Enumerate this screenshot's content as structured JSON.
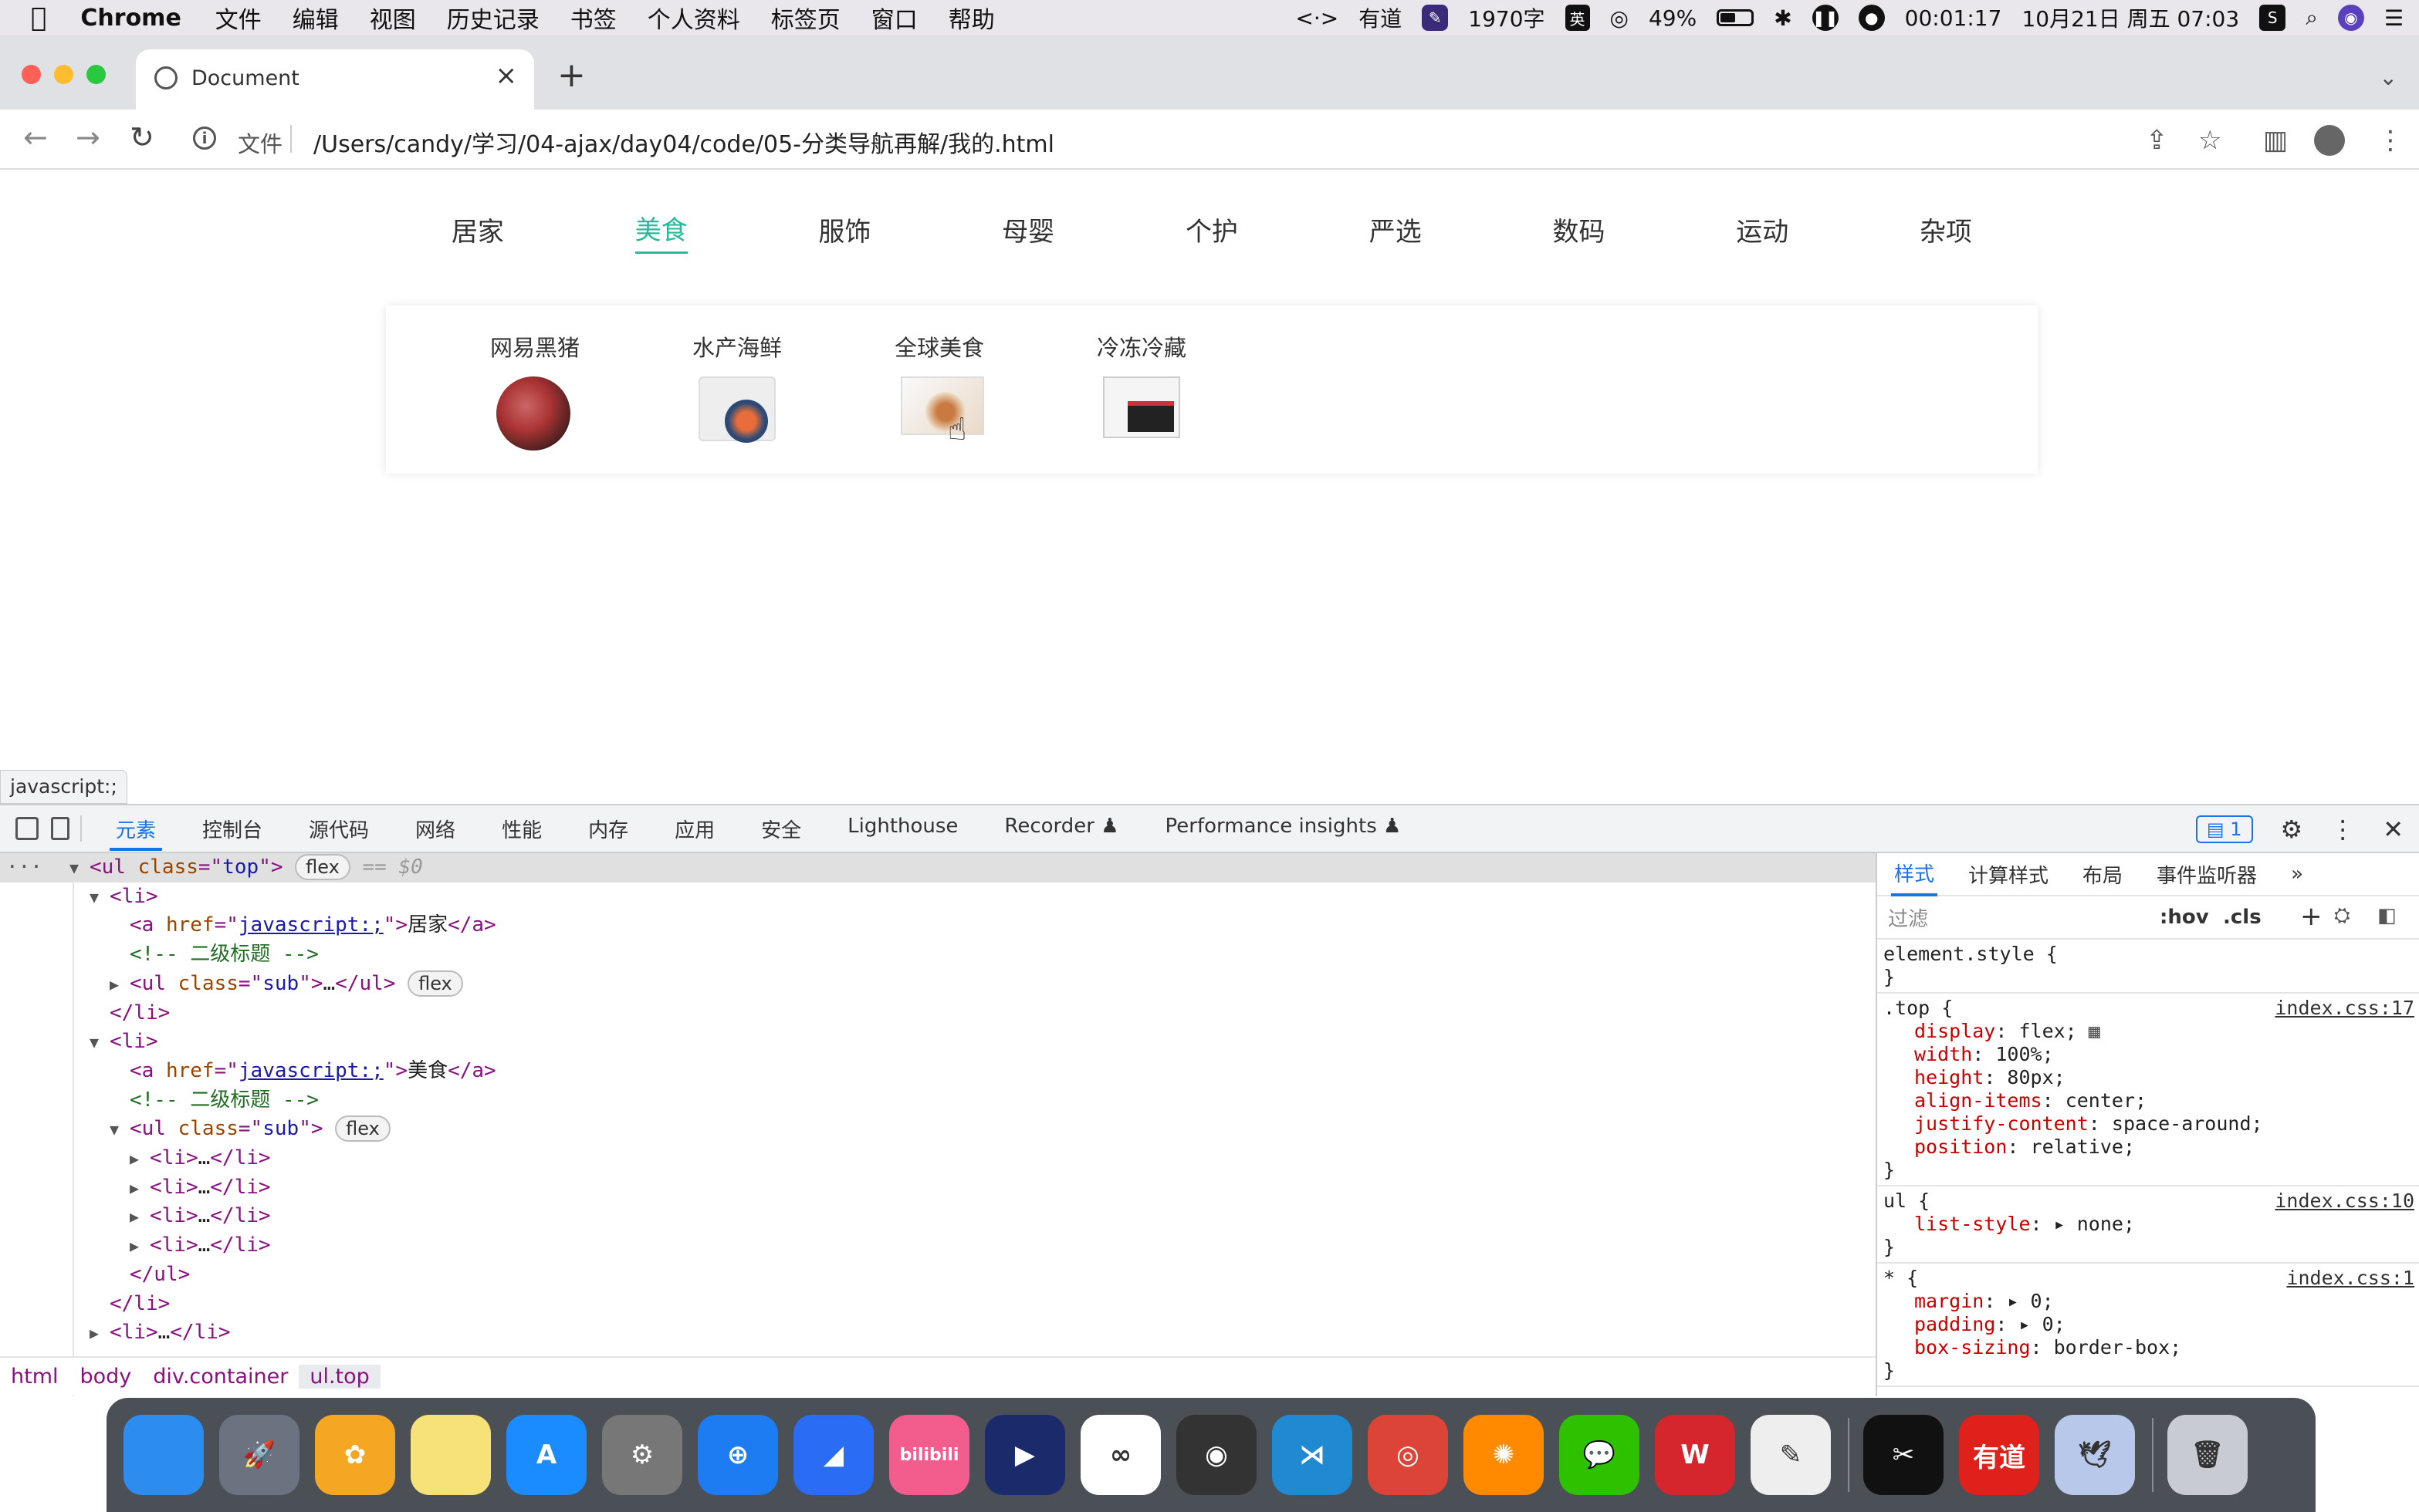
{
  "menubar": {
    "app": "Chrome",
    "items": [
      "文件",
      "编辑",
      "视图",
      "历史记录",
      "书签",
      "个人资料",
      "标签页",
      "窗口",
      "帮助"
    ],
    "status": {
      "youdao": "有道",
      "wordcount": "1970字",
      "ime": "英",
      "battery": "49%",
      "battery_level": 0.49,
      "timer": "00:01:17",
      "datetime": "10月21日 周五 07:03"
    }
  },
  "browser": {
    "tab_title": "Document",
    "scheme_label": "文件",
    "url": "/Users/candy/学习/04-ajax/day04/code/05-分类导航再解/我的.html"
  },
  "page": {
    "nav_items": [
      {
        "label": "居家",
        "active": false
      },
      {
        "label": "美食",
        "active": true
      },
      {
        "label": "服饰",
        "active": false
      },
      {
        "label": "母婴",
        "active": false
      },
      {
        "label": "个护",
        "active": false
      },
      {
        "label": "严选",
        "active": false
      },
      {
        "label": "数码",
        "active": false
      },
      {
        "label": "运动",
        "active": false
      },
      {
        "label": "杂项",
        "active": false
      }
    ],
    "accent_color": "#27ba9b",
    "sub_items": [
      {
        "name": "网易黑猪",
        "icon": "pork-image"
      },
      {
        "name": "水产海鲜",
        "icon": "seafood-image"
      },
      {
        "name": "全球美食",
        "icon": "global-food-image"
      },
      {
        "name": "冷冻冷藏",
        "icon": "frozen-food-image"
      }
    ],
    "status_tip": "javascript:;"
  },
  "devtools": {
    "tabs": [
      "元素",
      "控制台",
      "源代码",
      "网络",
      "性能",
      "内存",
      "应用",
      "安全",
      "Lighthouse",
      "Recorder ♟",
      "Performance insights ♟"
    ],
    "active_tab": "元素",
    "issues_count": "1",
    "dom_lines": [
      {
        "indent": 0,
        "tri": "▼",
        "parts": [
          [
            "tag",
            "<ul "
          ],
          [
            "attr",
            "class"
          ],
          [
            "tag",
            "=\""
          ],
          [
            "val",
            "top"
          ],
          [
            "tag",
            "\">"
          ]
        ],
        "pill": "flex",
        "suffix": " == $0",
        "selected": true
      },
      {
        "indent": 1,
        "tri": "▼",
        "parts": [
          [
            "tag",
            "<li>"
          ]
        ]
      },
      {
        "indent": 2,
        "tri": "",
        "parts": [
          [
            "tag",
            "<a "
          ],
          [
            "attr",
            "href"
          ],
          [
            "tag",
            "=\""
          ],
          [
            "link",
            "javascript:;"
          ],
          [
            "tag",
            "\">"
          ],
          [
            "txt",
            "居家"
          ],
          [
            "tag",
            "</a>"
          ]
        ]
      },
      {
        "indent": 2,
        "tri": "",
        "parts": [
          [
            "comment",
            "<!-- 二级标题 -->"
          ]
        ]
      },
      {
        "indent": 2,
        "tri": "▶",
        "parts": [
          [
            "tag",
            "<ul "
          ],
          [
            "attr",
            "class"
          ],
          [
            "tag",
            "=\""
          ],
          [
            "val",
            "sub"
          ],
          [
            "tag",
            "\">"
          ],
          [
            "txt",
            "…"
          ],
          [
            "tag",
            "</ul>"
          ]
        ],
        "pill": "flex"
      },
      {
        "indent": 1,
        "tri": "",
        "parts": [
          [
            "tag",
            "</li>"
          ]
        ]
      },
      {
        "indent": 1,
        "tri": "▼",
        "parts": [
          [
            "tag",
            "<li>"
          ]
        ]
      },
      {
        "indent": 2,
        "tri": "",
        "parts": [
          [
            "tag",
            "<a "
          ],
          [
            "attr",
            "href"
          ],
          [
            "tag",
            "=\""
          ],
          [
            "link",
            "javascript:;"
          ],
          [
            "tag",
            "\">"
          ],
          [
            "txt",
            "美食"
          ],
          [
            "tag",
            "</a>"
          ]
        ]
      },
      {
        "indent": 2,
        "tri": "",
        "parts": [
          [
            "comment",
            "<!-- 二级标题 -->"
          ]
        ]
      },
      {
        "indent": 2,
        "tri": "▼",
        "parts": [
          [
            "tag",
            "<ul "
          ],
          [
            "attr",
            "class"
          ],
          [
            "tag",
            "=\""
          ],
          [
            "val",
            "sub"
          ],
          [
            "tag",
            "\">"
          ]
        ],
        "pill": "flex"
      },
      {
        "indent": 3,
        "tri": "▶",
        "parts": [
          [
            "tag",
            "<li>"
          ],
          [
            "txt",
            "…"
          ],
          [
            "tag",
            "</li>"
          ]
        ]
      },
      {
        "indent": 3,
        "tri": "▶",
        "parts": [
          [
            "tag",
            "<li>"
          ],
          [
            "txt",
            "…"
          ],
          [
            "tag",
            "</li>"
          ]
        ]
      },
      {
        "indent": 3,
        "tri": "▶",
        "parts": [
          [
            "tag",
            "<li>"
          ],
          [
            "txt",
            "…"
          ],
          [
            "tag",
            "</li>"
          ]
        ]
      },
      {
        "indent": 3,
        "tri": "▶",
        "parts": [
          [
            "tag",
            "<li>"
          ],
          [
            "txt",
            "…"
          ],
          [
            "tag",
            "</li>"
          ]
        ]
      },
      {
        "indent": 2,
        "tri": "",
        "parts": [
          [
            "tag",
            "</ul>"
          ]
        ]
      },
      {
        "indent": 1,
        "tri": "",
        "parts": [
          [
            "tag",
            "</li>"
          ]
        ]
      },
      {
        "indent": 1,
        "tri": "▶",
        "parts": [
          [
            "tag",
            "<li>"
          ],
          [
            "txt",
            "…"
          ],
          [
            "tag",
            "</li>"
          ]
        ]
      }
    ],
    "breadcrumbs": [
      "html",
      "body",
      "div.container",
      "ul.top"
    ],
    "styles_tabs": [
      "样式",
      "计算样式",
      "布局",
      "事件监听器",
      "»"
    ],
    "filter_placeholder": "过滤",
    "hov": ":hov",
    "cls": ".cls",
    "rules": [
      {
        "selector": "element.style {",
        "source": "",
        "props": []
      },
      {
        "selector": ".top {",
        "source": "index.css:17",
        "props": [
          [
            "display",
            "flex;"
          ],
          [
            "width",
            "100%;"
          ],
          [
            "height",
            "80px;"
          ],
          [
            "align-items",
            "center;"
          ],
          [
            "justify-content",
            "space-around;"
          ],
          [
            "position",
            "relative;"
          ]
        ]
      },
      {
        "selector": "ul {",
        "source": "index.css:10",
        "props": [
          [
            "list-style",
            "▸ none;"
          ]
        ]
      },
      {
        "selector": "* {",
        "source": "index.css:1",
        "props": [
          [
            "margin",
            "▸ 0;"
          ],
          [
            "padding",
            "▸ 0;"
          ],
          [
            "box-sizing",
            "border-box;"
          ]
        ]
      }
    ]
  },
  "dock": {
    "apps": [
      {
        "name": "finder",
        "label": "",
        "color": "#2d8cf0"
      },
      {
        "name": "launchpad",
        "label": "🚀",
        "color": "#6b7280"
      },
      {
        "name": "photos",
        "label": "✿",
        "color": "#f5a623"
      },
      {
        "name": "notes",
        "label": "",
        "color": "#f7e27a"
      },
      {
        "name": "app-store",
        "label": "A",
        "color": "#1a8cff"
      },
      {
        "name": "system-preferences",
        "label": "⚙",
        "color": "#777"
      },
      {
        "name": "safari",
        "label": "⊕",
        "color": "#1d7cf2"
      },
      {
        "name": "feishu",
        "label": "◢",
        "color": "#2a6df4"
      },
      {
        "name": "bilibili",
        "label": "bilibili",
        "color": "#f25d8e"
      },
      {
        "name": "infuse",
        "label": "▶",
        "color": "#1b2a6b"
      },
      {
        "name": "baidu-netdisk",
        "label": "∞",
        "color": "#ffffff"
      },
      {
        "name": "mongodb-compass",
        "label": "◉",
        "color": "#333"
      },
      {
        "name": "vscode",
        "label": "⋊",
        "color": "#1f8ad2"
      },
      {
        "name": "chrome",
        "label": "◎",
        "color": "#db4437"
      },
      {
        "name": "color-app",
        "label": "✺",
        "color": "#ff8a00"
      },
      {
        "name": "wechat",
        "label": "💬",
        "color": "#2dc100"
      },
      {
        "name": "wps",
        "label": "W",
        "color": "#d4262c"
      },
      {
        "name": "textedit",
        "label": "✎",
        "color": "#eee"
      },
      {
        "name": "capcut",
        "label": "✂",
        "color": "#111"
      },
      {
        "name": "youdao",
        "label": "有道",
        "color": "#e0201a"
      },
      {
        "name": "feather",
        "label": "🕊",
        "color": "#b8c8ea"
      },
      {
        "name": "trash",
        "label": "🗑",
        "color": "#c8ccd2"
      }
    ]
  }
}
